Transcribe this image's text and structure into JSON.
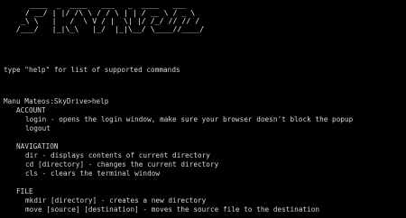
{
  "terminal": {
    "logo": "     ____  _  ____   ___   _  ____   ___ \n    / __/ | |/ /\\ \\ / / \\ | | / __ \\ / _ \\\n   _\\ \\   |   /  \\ V / |  \\| |/ /_/ // // /\n  /___/   |_|\\_\\   |_/  |_|\\__/ \\____//____/ ",
    "hint": "type \"help\" for list of supported commands",
    "prompt": "Manu Mateos:SkyDrive>help",
    "sections": [
      {
        "title": "ACCOUNT",
        "commands": [
          "login - opens the login window, make sure your browser doesn't block the popup",
          "logout"
        ]
      },
      {
        "title": "NAVIGATION",
        "commands": [
          "dir - displays contents of current directory",
          "cd [directory] - changes the current directory",
          "cls - clears the terminal window"
        ]
      },
      {
        "title": "FILE",
        "commands": [
          "mkdir [directory] - creates a new directory",
          "move [source] [destination] - moves the source file to the destination"
        ]
      }
    ]
  }
}
